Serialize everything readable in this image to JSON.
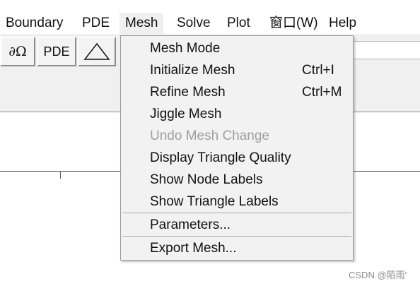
{
  "menubar": {
    "items": [
      {
        "label": "Boundary"
      },
      {
        "label": "PDE"
      },
      {
        "label": "Mesh"
      },
      {
        "label": "Solve"
      },
      {
        "label": "Plot"
      },
      {
        "label": "窗口(W)"
      },
      {
        "label": "Help"
      }
    ]
  },
  "toolbar": {
    "boundary_button": "∂Ω",
    "pde_button": "PDE",
    "triangle_icon": "triangle-icon"
  },
  "mesh_menu": {
    "items": [
      {
        "label": "Mesh Mode",
        "shortcut": ""
      },
      {
        "label": "Initialize Mesh",
        "shortcut": "Ctrl+I"
      },
      {
        "label": "Refine Mesh",
        "shortcut": "Ctrl+M"
      },
      {
        "label": "Jiggle Mesh",
        "shortcut": ""
      },
      {
        "label": "Undo Mesh Change",
        "shortcut": "",
        "disabled": true
      },
      {
        "label": "Display Triangle Quality",
        "shortcut": ""
      },
      {
        "label": "Show Node Labels",
        "shortcut": ""
      },
      {
        "label": "Show Triangle Labels",
        "shortcut": ""
      },
      {
        "label": "Parameters...",
        "shortcut": ""
      },
      {
        "label": "Export Mesh...",
        "shortcut": ""
      }
    ]
  },
  "watermark": "CSDN @陌雨'"
}
